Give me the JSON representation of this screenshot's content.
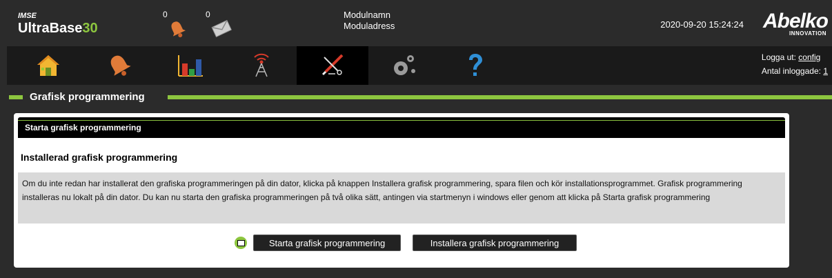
{
  "header": {
    "brand_top": "IMSE",
    "brand_main": "UltraBase",
    "brand_num": "30",
    "alarm_count": "0",
    "message_count": "0",
    "module_name": "Modulnamn",
    "module_address": "Moduladress",
    "datetime": "2020-09-20 15:24:24",
    "logo_main": "Abelko",
    "logo_sub": "INNOVATION"
  },
  "nav": {
    "items": [
      {
        "name": "home-icon"
      },
      {
        "name": "bell-icon"
      },
      {
        "name": "chart-icon"
      },
      {
        "name": "antenna-icon"
      },
      {
        "name": "tools-icon"
      },
      {
        "name": "gears-icon"
      },
      {
        "name": "help-icon"
      }
    ],
    "active_index": 4,
    "logout_label": "Logga ut:",
    "logout_user": "config",
    "logged_in_label": "Antal inloggade:",
    "logged_in_count": "1"
  },
  "section": {
    "title": "Grafisk programmering"
  },
  "panel": {
    "header": "Starta grafisk programmering",
    "subtitle": "Installerad grafisk programmering",
    "info_text": "Om du inte redan har installerat den grafiska programmeringen på din dator, klicka på knappen Installera grafisk programmering, spara filen och kör installationsprogrammet. Grafisk programmering installeras nu lokalt på din dator. Du kan nu starta den grafiska programmeringen på två olika sätt, antingen via startmenyn i windows eller genom att klicka på Starta grafisk programmering",
    "start_button": "Starta grafisk programmering",
    "install_button": "Installera grafisk programmering"
  },
  "colors": {
    "accent": "#8dc63f",
    "background": "#2b2b2b",
    "nav": "#1a1a1a"
  }
}
